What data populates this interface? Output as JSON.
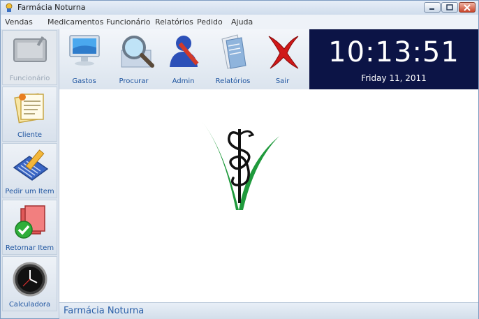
{
  "window": {
    "title": "Farmácia Noturna"
  },
  "menu": {
    "items": [
      "Vendas",
      "Medicamentos",
      "Funcionário",
      "Relatórios",
      "Pedido",
      "Ajuda"
    ]
  },
  "sidebar": {
    "items": [
      {
        "label": "Funcionário",
        "icon": "tablet-icon",
        "enabled": false
      },
      {
        "label": "Cliente",
        "icon": "notepad-icon",
        "enabled": true
      },
      {
        "label": "Pedir um Item",
        "icon": "keyboard-pencil-icon",
        "enabled": true
      },
      {
        "label": "Retornar Item",
        "icon": "return-check-icon",
        "enabled": true
      },
      {
        "label": "Calculadora",
        "icon": "clock-icon",
        "enabled": true
      }
    ]
  },
  "toolbar": {
    "items": [
      {
        "label": "Gastos",
        "icon": "monitor-icon"
      },
      {
        "label": "Procurar",
        "icon": "magnifier-icon"
      },
      {
        "label": "Admin",
        "icon": "admin-user-icon"
      },
      {
        "label": "Relatórios",
        "icon": "folder-icon"
      },
      {
        "label": "Sair",
        "icon": "exit-x-icon"
      }
    ]
  },
  "clock": {
    "time": "10:13:51",
    "date": "Friday 11, 2011"
  },
  "status": {
    "text": "Farmácia Noturna"
  },
  "colors": {
    "clock_bg": "#0c1446",
    "logo_green": "#1f9a3c",
    "label_blue": "#1f55a0",
    "exit_red": "#d01818"
  }
}
